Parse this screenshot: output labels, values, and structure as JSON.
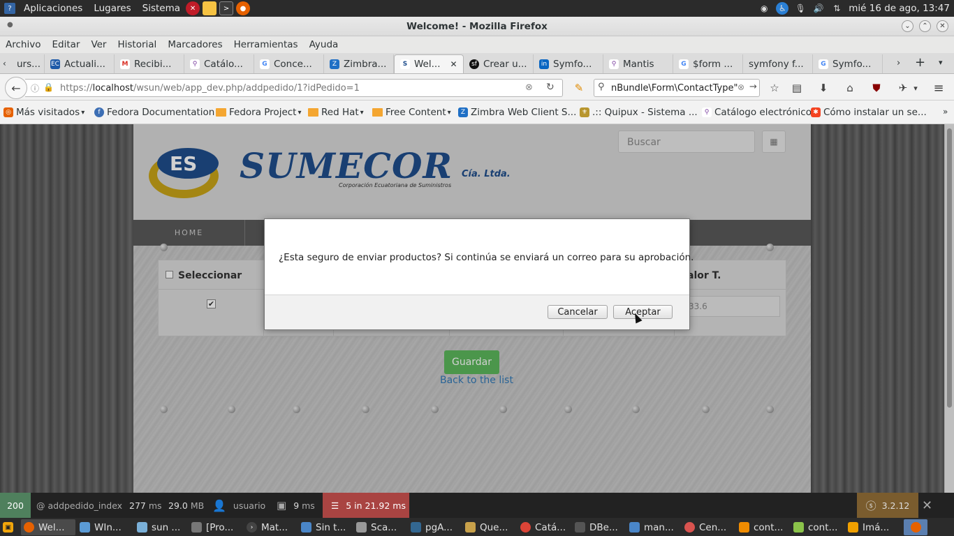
{
  "system_panel": {
    "apps_menu": "Aplicaciones",
    "places_menu": "Lugares",
    "system_menu": "Sistema",
    "clock": "mié 16 de ago, 13:47"
  },
  "window": {
    "title": "Welcome! - Mozilla Firefox"
  },
  "menubar": [
    "Archivo",
    "Editar",
    "Ver",
    "Historial",
    "Marcadores",
    "Herramientas",
    "Ayuda"
  ],
  "tabs": [
    {
      "label": "urs..."
    },
    {
      "label": "Actuali..."
    },
    {
      "label": "Recibi..."
    },
    {
      "label": "Catálo..."
    },
    {
      "label": "Conce..."
    },
    {
      "label": "Zimbra..."
    },
    {
      "label": "Wel...",
      "active": true
    },
    {
      "label": "Crear u..."
    },
    {
      "label": "Symfo..."
    },
    {
      "label": "Mantis"
    },
    {
      "label": "$form ..."
    },
    {
      "label": "symfony f..."
    },
    {
      "label": "Symfo..."
    }
  ],
  "navbar": {
    "url_prefix": "https://",
    "url_host": "localhost",
    "url_path": "/wsun/web/app_dev.php/addpedido/1?idPedido=1",
    "search_value": "nBundle\\Form\\ContactType\""
  },
  "bookmarks": [
    {
      "label": "Más visitados"
    },
    {
      "label": "Fedora Documentation"
    },
    {
      "label": "Fedora Project"
    },
    {
      "label": "Red Hat"
    },
    {
      "label": "Free Content"
    },
    {
      "label": "Zimbra Web Client S..."
    },
    {
      "label": ".:: Quipux - Sistema ..."
    },
    {
      "label": "Catálogo electrónico"
    },
    {
      "label": "Cómo instalar un se..."
    }
  ],
  "page": {
    "logo_name": "SUMECOR",
    "logo_suffix": "Cía. Ltda.",
    "logo_tagline": "Corporación Ecuatoriana de Suministros",
    "search_placeholder": "Buscar",
    "nav_home": "HOME",
    "table": {
      "select_header": "Seleccionar",
      "valor_header": "alor T.",
      "row_valor": "33.6"
    },
    "save_label": "Guardar",
    "back_link": "Back to the list"
  },
  "dialog": {
    "message": "¿Esta seguro de enviar productos? Si continúa se enviará un correo para su aprobación.",
    "cancel_label": "Cancelar",
    "accept_label": "Aceptar"
  },
  "symfony_toolbar": {
    "status_code": "200",
    "route": "@ addpedido_index",
    "time": "277",
    "time_unit": "ms",
    "memory": "29.0",
    "memory_unit": "MB",
    "user": "usuario",
    "twig_time": "9",
    "twig_unit": "ms",
    "db": "5 in 21.92 ms",
    "version": "3.2.12"
  },
  "taskbar": [
    {
      "label": "Wel...",
      "active": true
    },
    {
      "label": "WIn..."
    },
    {
      "label": "sun ..."
    },
    {
      "label": "[Pro..."
    },
    {
      "label": "Mat..."
    },
    {
      "label": "Sin t..."
    },
    {
      "label": "Sca..."
    },
    {
      "label": "pgA..."
    },
    {
      "label": "Que..."
    },
    {
      "label": "Catá..."
    },
    {
      "label": "DBe..."
    },
    {
      "label": "man..."
    },
    {
      "label": "Cen..."
    },
    {
      "label": "cont..."
    },
    {
      "label": "cont..."
    },
    {
      "label": "Imá..."
    }
  ],
  "colors": {
    "accent_green": "#5cb85c",
    "link_blue": "#337ab7",
    "logo_blue": "#1f4e8c",
    "symfony_error": "#a94442"
  }
}
